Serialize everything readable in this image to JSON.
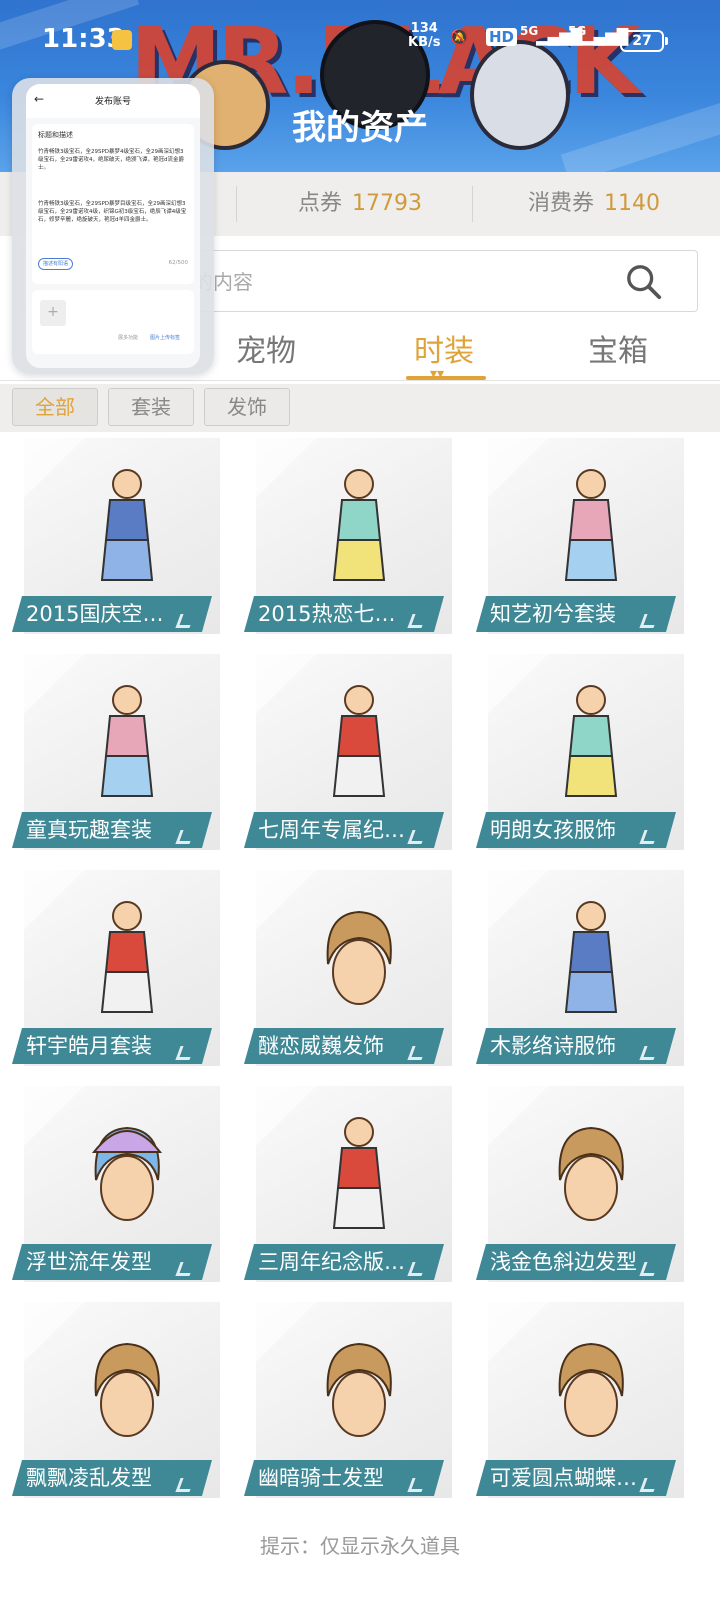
{
  "status_bar": {
    "time": "11:33",
    "net_speed_value": "134",
    "net_speed_unit": "KB/s",
    "hd_label": "HD",
    "sig1": "5G",
    "sig2": "5G",
    "battery": "27"
  },
  "header": {
    "title": "我的资产",
    "banner_text": "MR.BLACK"
  },
  "currency": {
    "items": [
      {
        "label": "点券",
        "value": "17793"
      },
      {
        "label": "消费券",
        "value": "1140"
      }
    ]
  },
  "search": {
    "placeholder": "的内容"
  },
  "tabs": [
    {
      "label": "宠物"
    },
    {
      "label": "时装"
    },
    {
      "label": "宝箱"
    }
  ],
  "filters": [
    {
      "label": "全部"
    },
    {
      "label": "套装"
    },
    {
      "label": "发饰"
    }
  ],
  "items": [
    {
      "name": "2015国庆空…",
      "icon": "outfit"
    },
    {
      "name": "2015热恋七…",
      "icon": "dress"
    },
    {
      "name": "知艺初兮套装",
      "icon": "girl"
    },
    {
      "name": "童真玩趣套装",
      "icon": "girl"
    },
    {
      "name": "七周年专属纪…",
      "icon": "boy"
    },
    {
      "name": "明朗女孩服饰",
      "icon": "dress"
    },
    {
      "name": "轩宇皓月套装",
      "icon": "boy"
    },
    {
      "name": "醚恋威巍发饰",
      "icon": "hair"
    },
    {
      "name": "木影络诗服饰",
      "icon": "outfit"
    },
    {
      "name": "浮世流年发型",
      "icon": "hat"
    },
    {
      "name": "三周年纪念版…",
      "icon": "boy"
    },
    {
      "name": "浅金色斜边发型",
      "icon": "hair"
    },
    {
      "name": "飘飘凌乱发型",
      "icon": "hair"
    },
    {
      "name": "幽暗骑士发型",
      "icon": "hair"
    },
    {
      "name": "可爱圆点蝴蝶…",
      "icon": "hair"
    }
  ],
  "hint": "提示：仅显示永久道具",
  "floating_window": {
    "title": "发布账号",
    "section_label": "标题和描述",
    "text1": "竹青畅铁3级宝石，全29SPD暴梦4级宝石，全29画深幻想3级宝石，全29雷诺攻4，绝尿破天，绝颁飞谭，艳冠d流金爵士。",
    "text2": "竹青畅铁3级宝石，全29SPD暴梦目级宝石，全29画深幻想3级宝石，全29雷诺攻4级，织锦G初3级宝石，绝辰飞谭4级宝石，修梦辛麓，绝旋破天，艳冠d羊四金爵士。",
    "tag": "描述有阳语",
    "count": "62/500",
    "more": "展多功能",
    "upload": "图片上传标签"
  }
}
